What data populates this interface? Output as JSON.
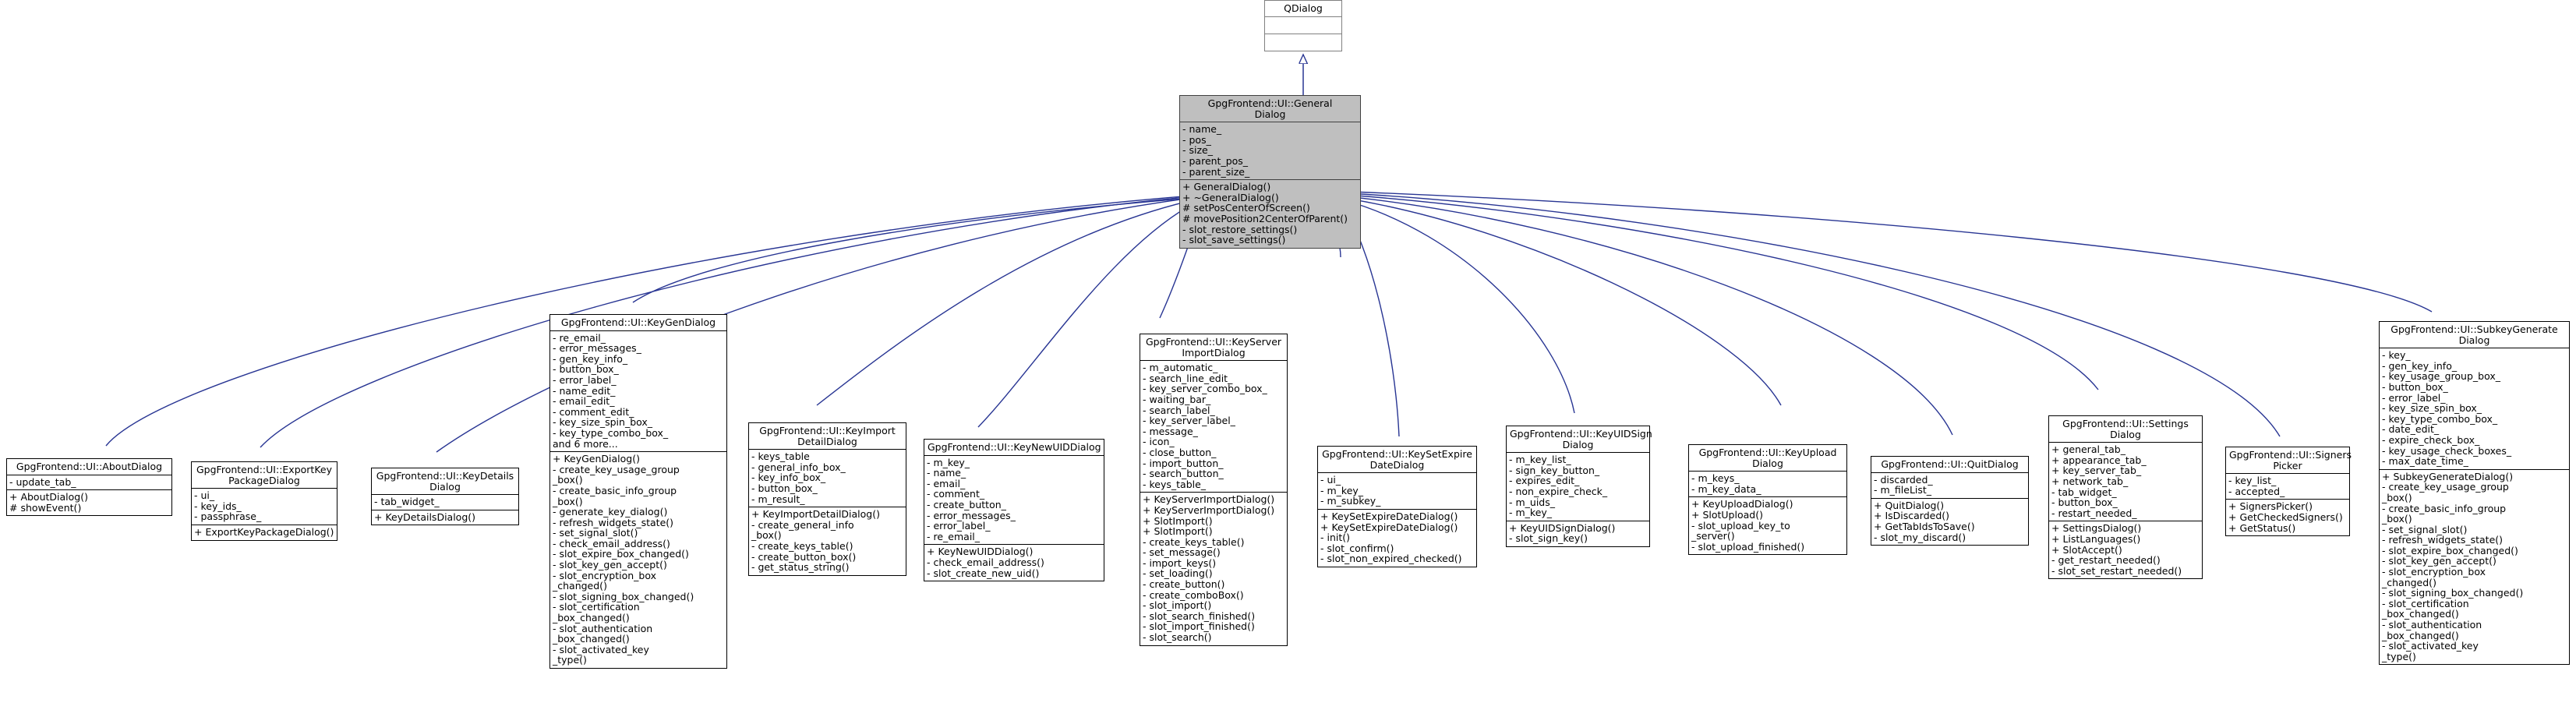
{
  "diagram": {
    "kind": "uml-inheritance-diagram",
    "edge_color": "#283593",
    "root_fill": "#bfbfbf",
    "node_fill": "#ffffff",
    "border_color": "#000000"
  },
  "nodes": {
    "qdialog": {
      "title": "QDialog",
      "attrs": "",
      "ops": ""
    },
    "general_dialog": {
      "title": "GpgFrontend::UI::General\nDialog",
      "attrs": "- name_\n- pos_\n- size_\n- parent_pos_\n- parent_size_",
      "ops": "+ GeneralDialog()\n+ ~GeneralDialog()\n# setPosCenterOfScreen()\n# movePosition2CenterOfParent()\n- slot_restore_settings()\n- slot_save_settings()"
    },
    "about_dialog": {
      "title": "GpgFrontend::UI::AboutDialog",
      "attrs": "- update_tab_",
      "ops": "+ AboutDialog()\n# showEvent()"
    },
    "export_key_package_dialog": {
      "title": "GpgFrontend::UI::ExportKey\nPackageDialog",
      "attrs": "- ui_\n- key_ids_\n- passphrase_",
      "ops": "+ ExportKeyPackageDialog()"
    },
    "key_details_dialog": {
      "title": "GpgFrontend::UI::KeyDetails\nDialog",
      "attrs": "- tab_widget_",
      "ops": "+ KeyDetailsDialog()"
    },
    "key_gen_dialog": {
      "title": "GpgFrontend::UI::KeyGenDialog",
      "attrs": "- re_email_\n- error_messages_\n- gen_key_info_\n- button_box_\n- error_label_\n- name_edit_\n- email_edit_\n- comment_edit_\n- key_size_spin_box_\n- key_type_combo_box_\nand 6 more...",
      "ops": "+ KeyGenDialog()\n- create_key_usage_group\n_box()\n- create_basic_info_group\n_box()\n- generate_key_dialog()\n- refresh_widgets_state()\n- set_signal_slot()\n- check_email_address()\n- slot_expire_box_changed()\n- slot_key_gen_accept()\n- slot_encryption_box\n_changed()\n- slot_signing_box_changed()\n- slot_certification\n_box_changed()\n- slot_authentication\n_box_changed()\n- slot_activated_key\n_type()"
    },
    "key_import_detail_dialog": {
      "title": "GpgFrontend::UI::KeyImport\nDetailDialog",
      "attrs": "- keys_table\n- general_info_box_\n- key_info_box_\n- button_box_\n- m_result_",
      "ops": "+ KeyImportDetailDialog()\n- create_general_info\n_box()\n- create_keys_table()\n- create_button_box()\n- get_status_string()"
    },
    "key_new_uid_dialog": {
      "title": "GpgFrontend::UI::KeyNewUIDDialog",
      "attrs": "- m_key_\n- name_\n- email_\n- comment_\n- create_button_\n- error_messages_\n- error_label_\n- re_email_",
      "ops": "+ KeyNewUIDDialog()\n- check_email_address()\n- slot_create_new_uid()"
    },
    "key_server_import_dialog": {
      "title": "GpgFrontend::UI::KeyServer\nImportDialog",
      "attrs": "- m_automatic_\n- search_line_edit_\n- key_server_combo_box_\n- waiting_bar_\n- search_label_\n- key_server_label_\n- message_\n- icon_\n- close_button_\n- import_button_\n- search_button_\n- keys_table_",
      "ops": "+ KeyServerImportDialog()\n+ KeyServerImportDialog()\n+ SlotImport()\n+ SlotImport()\n- create_keys_table()\n- set_message()\n- import_keys()\n- set_loading()\n- create_button()\n- create_comboBox()\n- slot_import()\n- slot_search_finished()\n- slot_import_finished()\n- slot_search()"
    },
    "key_set_expire_date_dialog": {
      "title": "GpgFrontend::UI::KeySetExpire\nDateDialog",
      "attrs": "- ui_\n- m_key_\n- m_subkey_",
      "ops": "+ KeySetExpireDateDialog()\n+ KeySetExpireDateDialog()\n- init()\n- slot_confirm()\n- slot_non_expired_checked()"
    },
    "key_uid_sign_dialog": {
      "title": "GpgFrontend::UI::KeyUIDSign\nDialog",
      "attrs": "- m_key_list_\n- sign_key_button_\n- expires_edit_\n- non_expire_check_\n- m_uids_\n- m_key_",
      "ops": "+ KeyUIDSignDialog()\n- slot_sign_key()"
    },
    "key_upload_dialog": {
      "title": "GpgFrontend::UI::KeyUpload\nDialog",
      "attrs": "- m_keys_\n- m_key_data_",
      "ops": "+ KeyUploadDialog()\n+ SlotUpload()\n- slot_upload_key_to\n_server()\n- slot_upload_finished()"
    },
    "quit_dialog": {
      "title": "GpgFrontend::UI::QuitDialog",
      "attrs": "- discarded_\n- m_fileList_",
      "ops": "+ QuitDialog()\n+ IsDiscarded()\n+ GetTabIdsToSave()\n- slot_my_discard()"
    },
    "settings_dialog": {
      "title": "GpgFrontend::UI::Settings\nDialog",
      "attrs": "+ general_tab_\n+ appearance_tab_\n+ key_server_tab_\n+ network_tab_\n- tab_widget_\n- button_box_\n- restart_needed_",
      "ops": "+ SettingsDialog()\n+ ListLanguages()\n+ SlotAccept()\n- get_restart_needed()\n- slot_set_restart_needed()"
    },
    "signers_picker": {
      "title": "GpgFrontend::UI::Signers\nPicker",
      "attrs": "- key_list_\n- accepted_",
      "ops": "+ SignersPicker()\n+ GetCheckedSigners()\n+ GetStatus()"
    },
    "subkey_generate_dialog": {
      "title": "GpgFrontend::UI::SubkeyGenerate\nDialog",
      "attrs": "- key_\n- gen_key_info_\n- key_usage_group_box_\n- button_box_\n- error_label_\n- key_size_spin_box_\n- key_type_combo_box_\n- date_edit_\n- expire_check_box_\n- key_usage_check_boxes_\n- max_date_time_",
      "ops": "+ SubkeyGenerateDialog()\n- create_key_usage_group\n_box()\n- create_basic_info_group\n_box()\n- set_signal_slot()\n- refresh_widgets_state()\n- slot_expire_box_changed()\n- slot_key_gen_accept()\n- slot_encryption_box\n_changed()\n- slot_signing_box_changed()\n- slot_certification\n_box_changed()\n- slot_authentication\n_box_changed()\n- slot_activated_key\n_type()"
    }
  }
}
